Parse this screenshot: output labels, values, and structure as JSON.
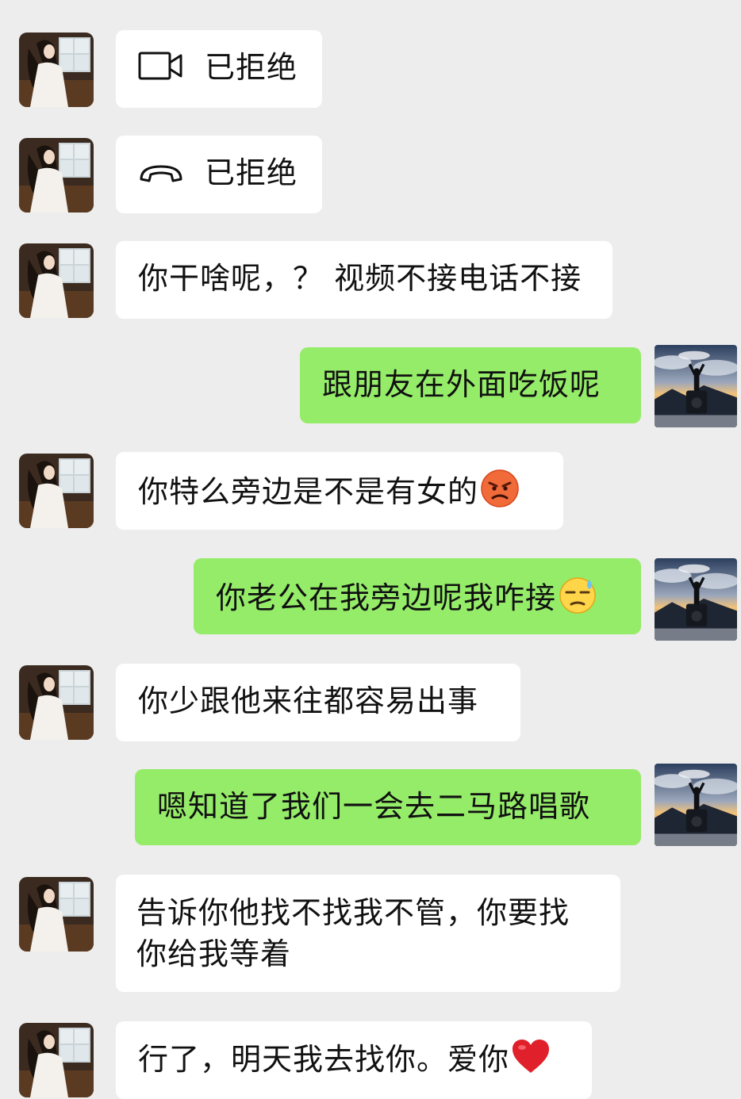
{
  "messages": [
    {
      "side": "in",
      "kind": "video-call",
      "text": "已拒绝"
    },
    {
      "side": "in",
      "kind": "voice-call",
      "text": "已拒绝"
    },
    {
      "side": "in",
      "kind": "text",
      "text": "你干啥呢，？ 视频不接电话不接"
    },
    {
      "side": "out",
      "kind": "text",
      "text": "跟朋友在外面吃饭呢"
    },
    {
      "side": "in",
      "kind": "text",
      "text": "你特么旁边是不是有女的",
      "emoji": "angry-face-emoji"
    },
    {
      "side": "out",
      "kind": "text",
      "text": "你老公在我旁边呢我咋接",
      "emoji": "sweat-face-emoji"
    },
    {
      "side": "in",
      "kind": "text",
      "text": "你少跟他来往都容易出事"
    },
    {
      "side": "out",
      "kind": "text",
      "text": "嗯知道了我们一会去二马路唱歌"
    },
    {
      "side": "in",
      "kind": "text",
      "text": "告诉你他找不找我不管，你要找你给我等着"
    },
    {
      "side": "in",
      "kind": "text",
      "text": "行了，明天我去找你。爱你",
      "emoji": "red-heart-emoji"
    }
  ],
  "colors": {
    "background": "#ededed",
    "incoming_bubble": "#ffffff",
    "outgoing_bubble": "#95ec69"
  }
}
